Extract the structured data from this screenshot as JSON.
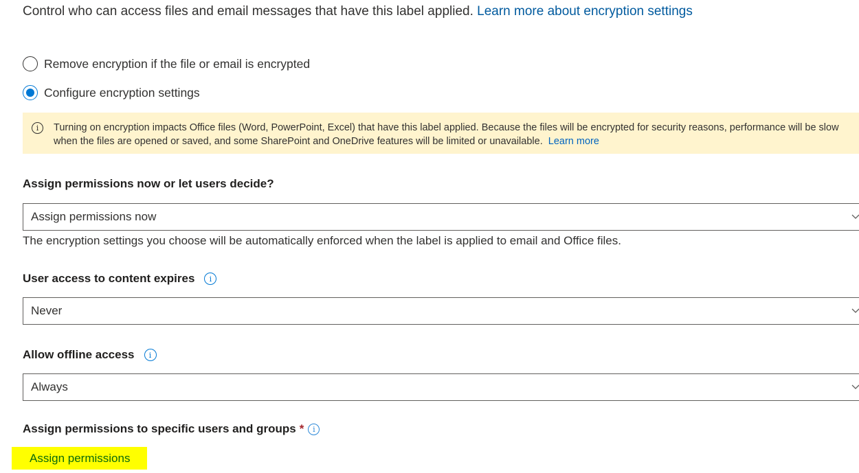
{
  "intro": {
    "text": "Control who can access files and email messages that have this label applied.",
    "link": "Learn more about encryption settings"
  },
  "encryption_options": [
    {
      "label": "Remove encryption if the file or email is encrypted",
      "selected": false
    },
    {
      "label": "Configure encryption settings",
      "selected": true
    }
  ],
  "warning": {
    "icon": "info-icon",
    "line1": "Turning on encryption impacts Office files (Word, PowerPoint, Excel) that have this label applied. Because the files will be encrypted for security reasons, performance will be slow",
    "line2": "when the files are opened or saved, and some SharePoint and OneDrive features will be limited or unavailable.",
    "link": "Learn more"
  },
  "assign_mode": {
    "label": "Assign permissions now or let users decide?",
    "value": "Assign permissions now",
    "helper": "The encryption settings you choose will be automatically enforced when the label is applied to email and Office files."
  },
  "expires": {
    "label": "User access to content expires",
    "value": "Never"
  },
  "offline": {
    "label": "Allow offline access",
    "value": "Always"
  },
  "specific": {
    "label": "Assign permissions to specific users and groups",
    "required": "*",
    "action": "Assign permissions",
    "highlight_color": "#ffff00"
  },
  "colors": {
    "accent": "#0078d4",
    "warning_bg": "#fff4ce",
    "required": "#a4262c"
  }
}
